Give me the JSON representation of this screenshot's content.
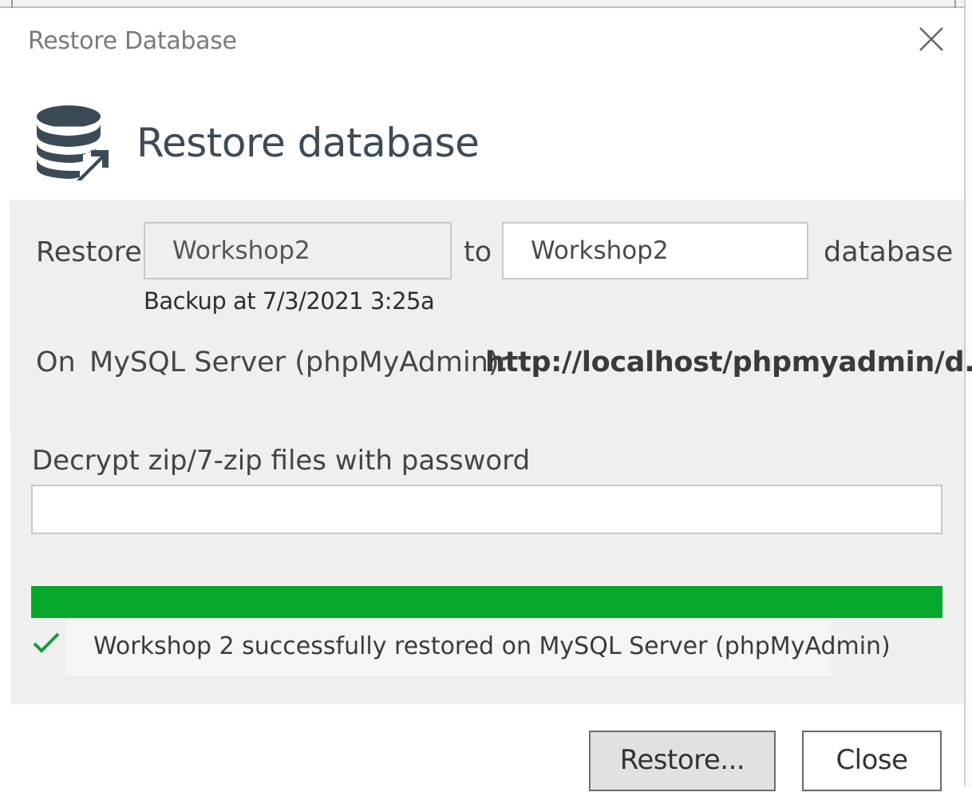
{
  "window": {
    "title": "Restore Database",
    "close_icon": "close-icon"
  },
  "header": {
    "icon": "database-restore-icon",
    "title": "Restore database"
  },
  "restore_row": {
    "restore_label": "Restore",
    "source_value": "Workshop2",
    "to_label": "to",
    "target_value": "Workshop2",
    "database_label": "database",
    "backup_info": "Backup at 7/3/2021 3:25a"
  },
  "server_row": {
    "on_label": "On",
    "server_name": "MySQL Server (phpMyAdmin):",
    "server_url": "http://localhost/phpmyadmin/d..."
  },
  "password": {
    "label": "Decrypt zip/7-zip files with password",
    "value": ""
  },
  "progress": {
    "percent": 100,
    "color": "#05a82a"
  },
  "status": {
    "icon": "checkmark-icon",
    "color": "#1a9b3a",
    "message": "Workshop 2 successfully restored on MySQL Server (phpMyAdmin)"
  },
  "buttons": {
    "restore_label": "Restore...",
    "close_label": "Close"
  }
}
